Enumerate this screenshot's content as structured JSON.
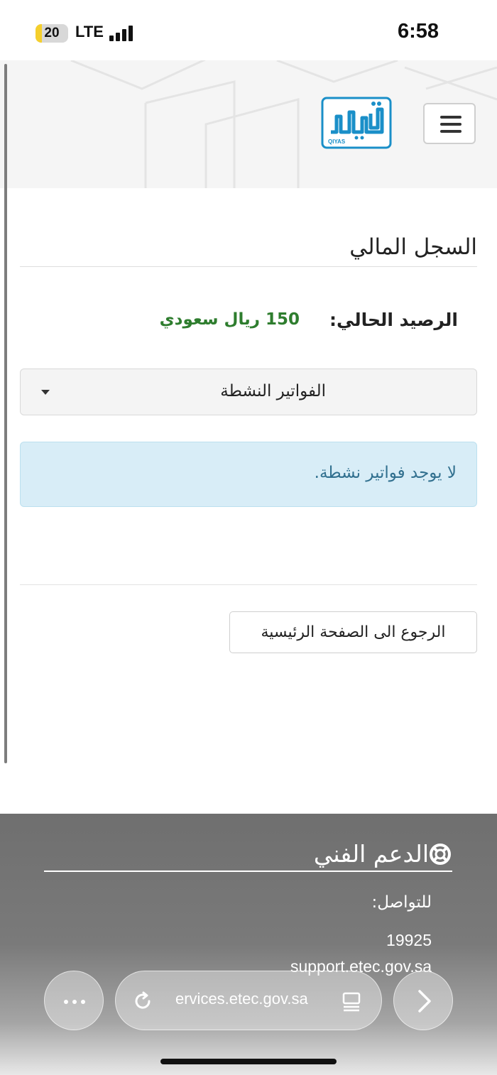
{
  "status_bar": {
    "battery": "20",
    "battery_level": 0.2,
    "network": "LTE",
    "time": "6:58"
  },
  "header": {
    "logo_text": "QIYAS"
  },
  "page": {
    "title": "السجل المالي",
    "balance_label": "الرصيد الحالي",
    "balance_colon": ":",
    "balance_value": "150 ريال سعودي",
    "invoice_filter": "الفواتير النشطة",
    "alert_message": "لا يوجد فواتير نشطة.",
    "back_button": "الرجوع الى الصفحة الرئيسية"
  },
  "footer": {
    "title": "الدعم الفني",
    "contact_label": "للتواصل:",
    "phone": "19925",
    "email": "support.etec.gov.sa"
  },
  "browser": {
    "url": "ervices.etec.gov.sa"
  },
  "colors": {
    "accent_green": "#2e7d2e",
    "alert_bg": "#d8edf7",
    "logo_blue": "#1a8fc8"
  }
}
